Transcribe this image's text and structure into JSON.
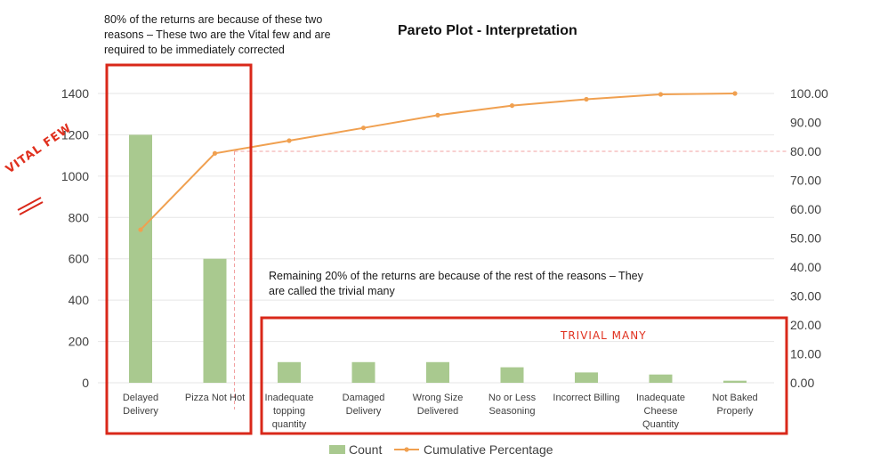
{
  "chart_data": {
    "type": "bar",
    "title": "Pareto Plot - Interpretation",
    "categories": [
      [
        "Delayed",
        "Delivery"
      ],
      [
        "Pizza Not Hot"
      ],
      [
        "Inadequate",
        "topping",
        "quantity"
      ],
      [
        "Damaged",
        "Delivery"
      ],
      [
        "Wrong Size",
        "Delivered"
      ],
      [
        "No or Less",
        "Seasoning"
      ],
      [
        "Incorrect Billing"
      ],
      [
        "Inadequate",
        "Cheese",
        "Quantity"
      ],
      [
        "Not Baked",
        "Properly"
      ]
    ],
    "series": [
      {
        "name": "Count",
        "type": "bar",
        "axis": "left",
        "color": "#a9c98f",
        "values": [
          1200,
          600,
          100,
          100,
          100,
          75,
          50,
          40,
          10
        ]
      },
      {
        "name": "Cumulative Percentage",
        "type": "line",
        "axis": "right",
        "color": "#f0a050",
        "values": [
          52.9,
          79.3,
          83.7,
          88.1,
          92.5,
          95.8,
          98.0,
          99.7,
          100.0
        ]
      }
    ],
    "y_left": {
      "min": 0,
      "max": 1400,
      "ticks": [
        "0",
        "200",
        "400",
        "600",
        "800",
        "1000",
        "1200",
        "1400"
      ]
    },
    "y_right": {
      "min": 0,
      "max": 100,
      "ticks": [
        "0.00",
        "10.00",
        "20.00",
        "30.00",
        "40.00",
        "50.00",
        "60.00",
        "70.00",
        "80.00",
        "90.00",
        "100.00"
      ]
    },
    "reference_line": 80,
    "legend": [
      "Count",
      "Cumulative Percentage"
    ],
    "legend_position": "bottom",
    "annotations": {
      "top": "80% of the returns are because of these two reasons – These two are the Vital few and are required to be immediately corrected",
      "middle": "Remaining 20% of the returns are because of the rest of the reasons – They are called the trivial many",
      "handwritten_left": "VITAL FEW",
      "handwritten_right": "TRIVIAL MANY"
    },
    "highlight_color": "#d9281a"
  }
}
